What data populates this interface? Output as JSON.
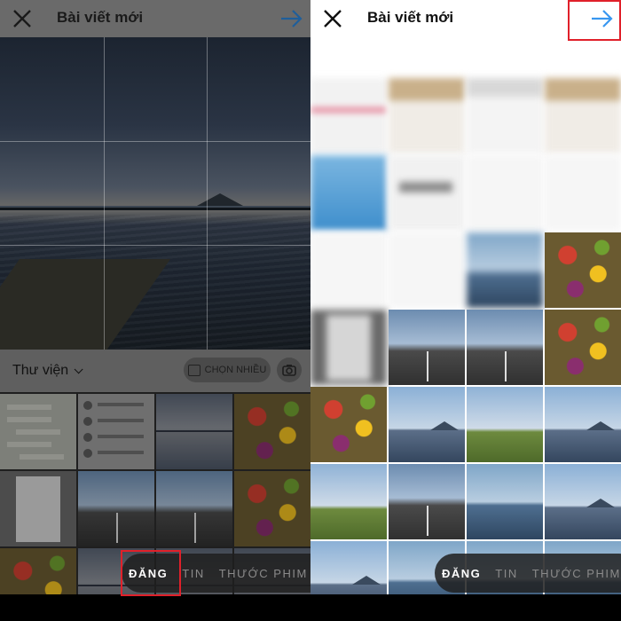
{
  "left": {
    "header": {
      "title": "Bài viết mới",
      "close_icon": "close-icon",
      "next_icon": "arrow-right-icon"
    },
    "library": {
      "label": "Thư viện",
      "multi_select": "CHỌN NHIỀU",
      "camera_icon": "camera-icon"
    },
    "modes": {
      "post": "ĐĂNG",
      "story": "TIN",
      "reels": "THƯỚC PHIM"
    }
  },
  "right": {
    "header": {
      "title": "Bài viết mới",
      "close_icon": "close-icon",
      "next_icon": "arrow-right-icon"
    },
    "modes": {
      "post": "ĐĂNG",
      "story": "TIN",
      "reels": "THƯỚC PHIM"
    }
  },
  "colors": {
    "accent": "#3897f0",
    "highlight": "#e0202a"
  }
}
